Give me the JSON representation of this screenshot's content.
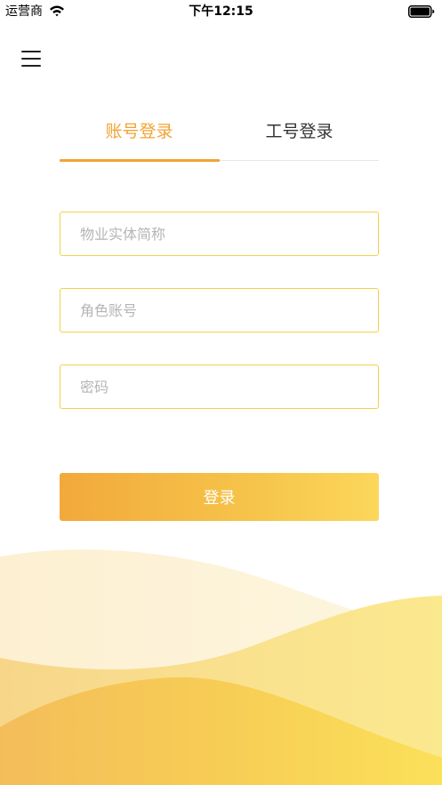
{
  "status_bar": {
    "carrier": "运营商",
    "time": "下午12:15",
    "wifi_icon": "wifi-icon",
    "battery_icon": "battery-full-icon"
  },
  "header": {
    "menu_icon": "hamburger-menu-icon"
  },
  "tabs": [
    {
      "label": "账号登录",
      "active": true
    },
    {
      "label": "工号登录",
      "active": false
    }
  ],
  "form": {
    "entity_placeholder": "物业实体简称",
    "entity_value": "",
    "role_account_placeholder": "角色账号",
    "role_account_value": "",
    "password_placeholder": "密码",
    "password_value": ""
  },
  "login_button": {
    "label": "登录"
  },
  "colors": {
    "accent": "#f0a434",
    "field_border": "#f4d148",
    "button_start": "#f2a93b",
    "button_end": "#fbd75a",
    "inactive_tab": "#333333",
    "placeholder": "#b5b5b5",
    "wave_light": "#fdf1d4",
    "wave_mid": "#f9e38c",
    "wave_dark": "#f6c54b"
  }
}
